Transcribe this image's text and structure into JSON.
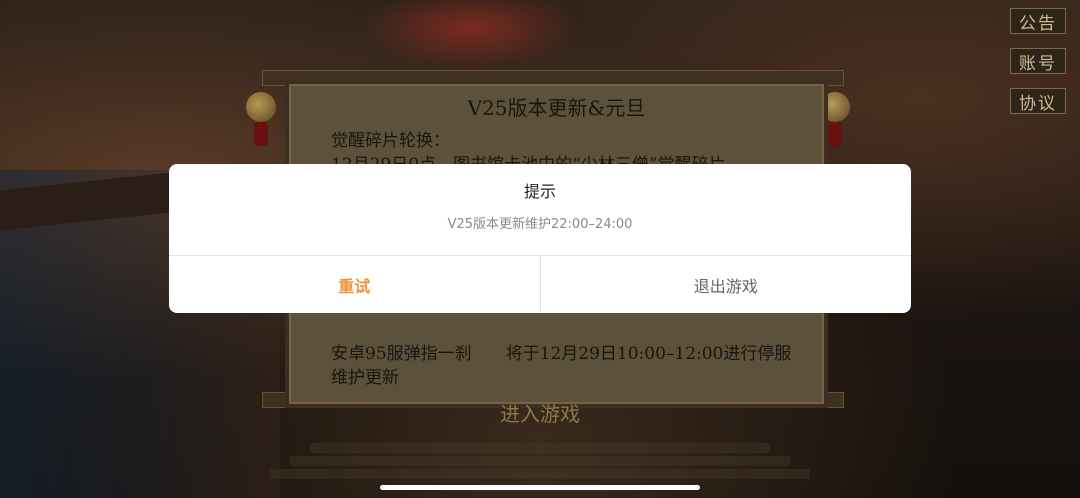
{
  "right_menu": {
    "notice_label": "公告",
    "account_label": "账号",
    "agreement_label": "协议"
  },
  "announcement": {
    "title": "V25版本更新&元旦",
    "section_heading": "觉醒碎片轮换：",
    "partial_line": "12月29日0点，图书馆卡池中的“少林三僧”觉醒碎片",
    "maintenance_notice": "安卓95服弹指一刹　　将于12月29日10:00–12:00进行停服维护更新"
  },
  "enter_game_label": "进入游戏",
  "dialog": {
    "title": "提示",
    "message": "V25版本更新维护22:00–24:00",
    "retry_label": "重试",
    "quit_label": "退出游戏",
    "colors": {
      "retry": "#f0913a",
      "quit": "#666666"
    }
  }
}
